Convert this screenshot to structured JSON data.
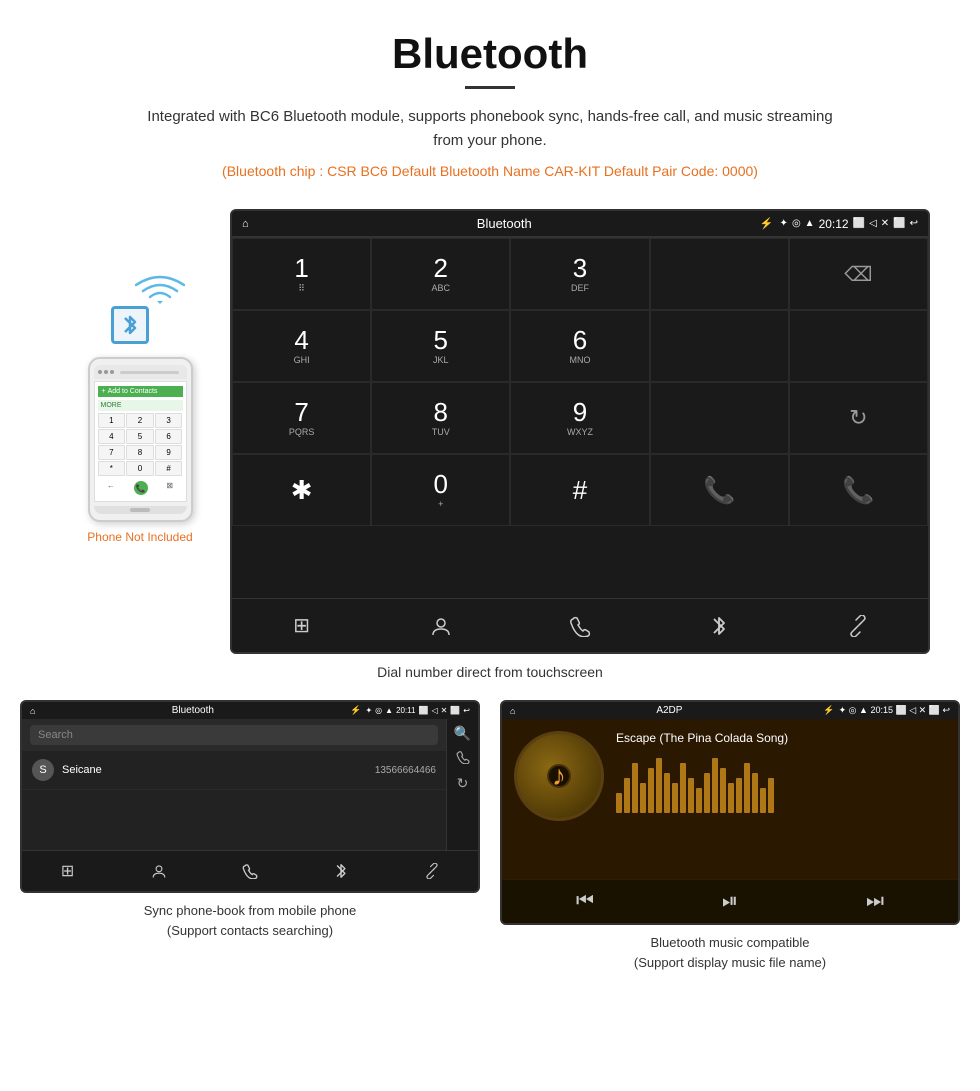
{
  "header": {
    "title": "Bluetooth",
    "description": "Integrated with BC6 Bluetooth module, supports phonebook sync, hands-free call, and music streaming from your phone.",
    "specs": "(Bluetooth chip : CSR BC6    Default Bluetooth Name CAR-KIT    Default Pair Code: 0000)"
  },
  "dial_screen": {
    "title": "Bluetooth",
    "time": "20:12",
    "keys": [
      {
        "num": "1",
        "sub": ""
      },
      {
        "num": "2",
        "sub": "ABC"
      },
      {
        "num": "3",
        "sub": "DEF"
      },
      {
        "num": "",
        "sub": ""
      },
      {
        "num": "⌫",
        "sub": ""
      },
      {
        "num": "4",
        "sub": "GHI"
      },
      {
        "num": "5",
        "sub": "JKL"
      },
      {
        "num": "6",
        "sub": "MNO"
      },
      {
        "num": "",
        "sub": ""
      },
      {
        "num": "",
        "sub": ""
      },
      {
        "num": "7",
        "sub": "PQRS"
      },
      {
        "num": "8",
        "sub": "TUV"
      },
      {
        "num": "9",
        "sub": "WXYZ"
      },
      {
        "num": "",
        "sub": ""
      },
      {
        "num": "↻",
        "sub": ""
      },
      {
        "num": "*",
        "sub": ""
      },
      {
        "num": "0",
        "sub": "+"
      },
      {
        "num": "#",
        "sub": ""
      },
      {
        "num": "📞",
        "sub": "green"
      },
      {
        "num": "📞",
        "sub": "red"
      }
    ]
  },
  "dial_caption": "Dial number direct from touchscreen",
  "phonebook_screen": {
    "title": "Bluetooth",
    "time": "20:11",
    "search_placeholder": "Search",
    "contact_name": "Seicane",
    "contact_number": "13566664466"
  },
  "music_screen": {
    "title": "A2DP",
    "time": "20:15",
    "song_title": "Escape (The Pina Colada Song)",
    "eq_bars": [
      20,
      35,
      50,
      30,
      45,
      55,
      40,
      30,
      50,
      35,
      25,
      40,
      55,
      45,
      30,
      35,
      50,
      40,
      25,
      35
    ]
  },
  "phone_not_included": "Phone Not Included",
  "caption_phonebook": "Sync phone-book from mobile phone\n(Support contacts searching)",
  "caption_music": "Bluetooth music compatible\n(Support display music file name)"
}
